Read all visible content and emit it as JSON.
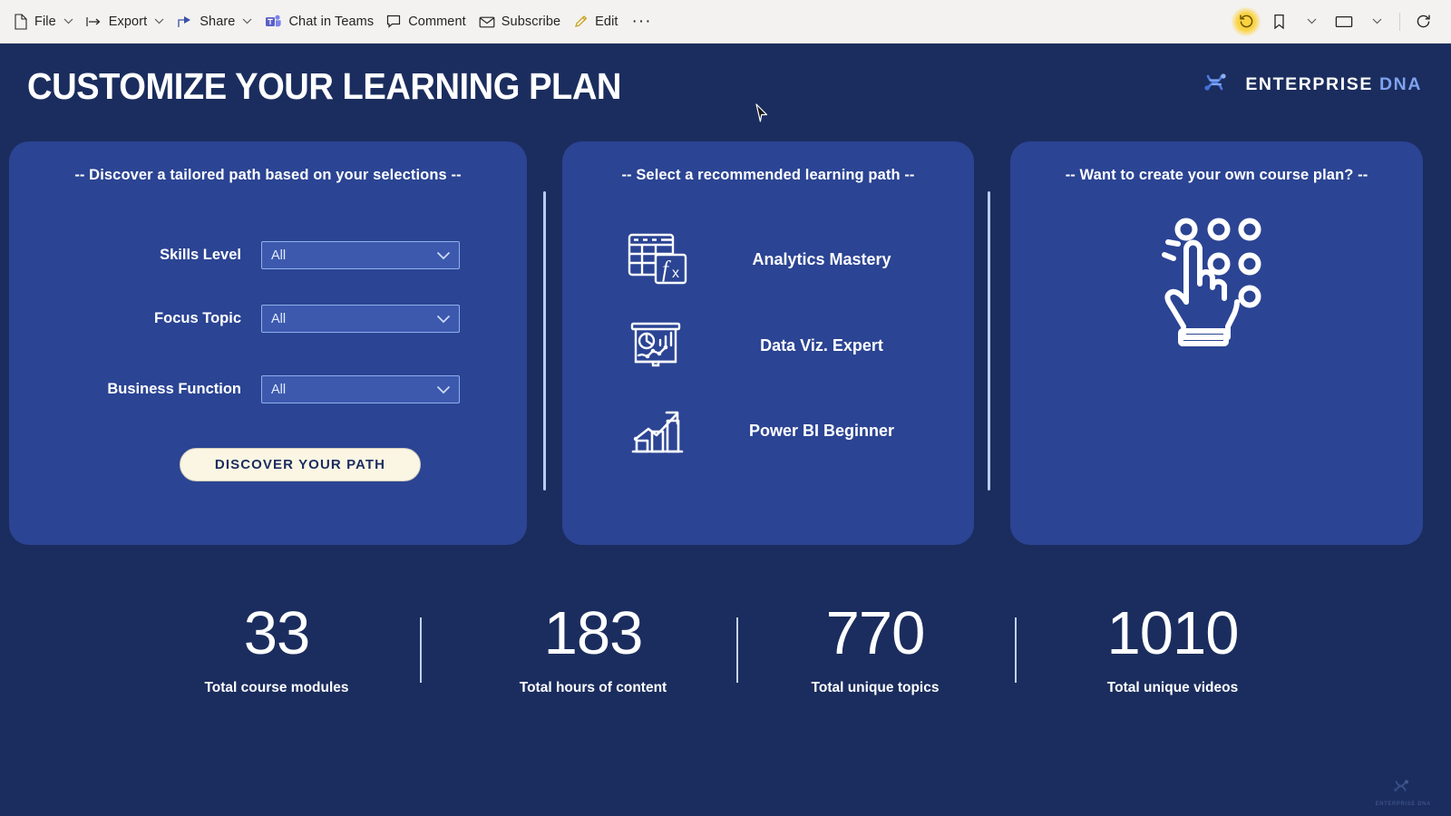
{
  "toolbar": {
    "items": [
      {
        "label": "File",
        "icon": "file-icon",
        "chevron": true
      },
      {
        "label": "Export",
        "icon": "export-icon",
        "chevron": true
      },
      {
        "label": "Share",
        "icon": "share-icon",
        "chevron": true
      },
      {
        "label": "Chat in Teams",
        "icon": "teams-icon",
        "chevron": false
      },
      {
        "label": "Comment",
        "icon": "comment-icon",
        "chevron": false
      },
      {
        "label": "Subscribe",
        "icon": "mail-icon",
        "chevron": false
      },
      {
        "label": "Edit",
        "icon": "pencil-icon",
        "chevron": false
      }
    ],
    "overflow_label": "···",
    "right_icons": [
      {
        "name": "reset-icon",
        "highlighted": true
      },
      {
        "name": "bookmark-icon",
        "highlighted": false
      },
      {
        "name": "view-icon",
        "highlighted": false
      },
      {
        "name": "refresh-icon",
        "highlighted": false
      }
    ]
  },
  "report": {
    "title": "CUSTOMIZE YOUR LEARNING PLAN",
    "brand": {
      "primary": "ENTERPRISE",
      "secondary": "DNA",
      "icon": "dna-helix-icon"
    },
    "background_color": "#1b2d5e",
    "card_color": "#2b4493",
    "accent_color": "#fbf6e4"
  },
  "card_filters": {
    "heading": "-- Discover a tailored path based on your selections --",
    "slicers": [
      {
        "label": "Skills Level",
        "value": "All"
      },
      {
        "label": "Focus Topic",
        "value": "All"
      },
      {
        "label": "Business Function",
        "value": "All"
      }
    ],
    "button_label": "DISCOVER YOUR PATH"
  },
  "card_paths": {
    "heading": "-- Select a recommended learning path --",
    "paths": [
      {
        "label": "Analytics Mastery",
        "icon": "spreadsheet-formula-icon"
      },
      {
        "label": "Data Viz. Expert",
        "icon": "presentation-chart-icon"
      },
      {
        "label": "Power BI Beginner",
        "icon": "bar-chart-growth-icon"
      }
    ]
  },
  "card_custom": {
    "heading": "-- Want to create your own course plan?  --",
    "icon": "hand-select-icon"
  },
  "kpis": [
    {
      "value": "33",
      "label": "Total course modules"
    },
    {
      "value": "183",
      "label": "Total hours of content"
    },
    {
      "value": "770",
      "label": "Total unique topics"
    },
    {
      "value": "1010",
      "label": "Total unique videos"
    }
  ],
  "watermark": {
    "primary": "ENTERPRISE",
    "secondary": "DNA"
  }
}
